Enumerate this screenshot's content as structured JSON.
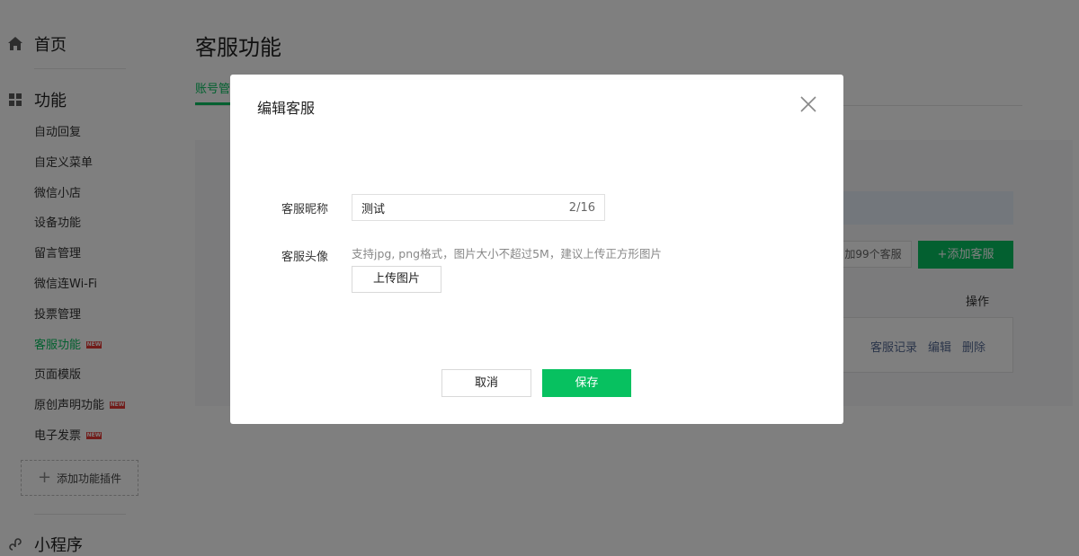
{
  "sidebar": {
    "home_label": "首页",
    "features_label": "功能",
    "items": [
      {
        "label": "自动回复",
        "new": false
      },
      {
        "label": "自定义菜单",
        "new": false
      },
      {
        "label": "微信小店",
        "new": false
      },
      {
        "label": "设备功能",
        "new": false
      },
      {
        "label": "留言管理",
        "new": false
      },
      {
        "label": "微信连Wi-Fi",
        "new": false
      },
      {
        "label": "投票管理",
        "new": false
      },
      {
        "label": "客服功能",
        "new": true,
        "active": true
      },
      {
        "label": "页面模版",
        "new": false
      },
      {
        "label": "原创声明功能",
        "new": true
      },
      {
        "label": "电子发票",
        "new": true
      }
    ],
    "new_badge": "NEW",
    "add_plugin_label": "添加功能插件",
    "mini_program_label": "小程序"
  },
  "main": {
    "title": "客服功能",
    "tab_label": "账号管",
    "limit_text": "加99个客服",
    "add_button": "+添加客服",
    "table_header_ops": "操作",
    "row_actions": [
      "客服记录",
      "编辑",
      "删除"
    ]
  },
  "dialog": {
    "title": "编辑客服",
    "nickname_label": "客服昵称",
    "nickname_value": "测试",
    "nickname_counter": "2/16",
    "avatar_label": "客服头像",
    "avatar_hint": "支持jpg, png格式，图片大小不超过5M，建议上传正方形图片",
    "upload_button": "上传图片",
    "cancel_button": "取消",
    "save_button": "保存"
  },
  "colors": {
    "accent": "#07c160",
    "link": "#576b95",
    "badge": "#e53935"
  }
}
